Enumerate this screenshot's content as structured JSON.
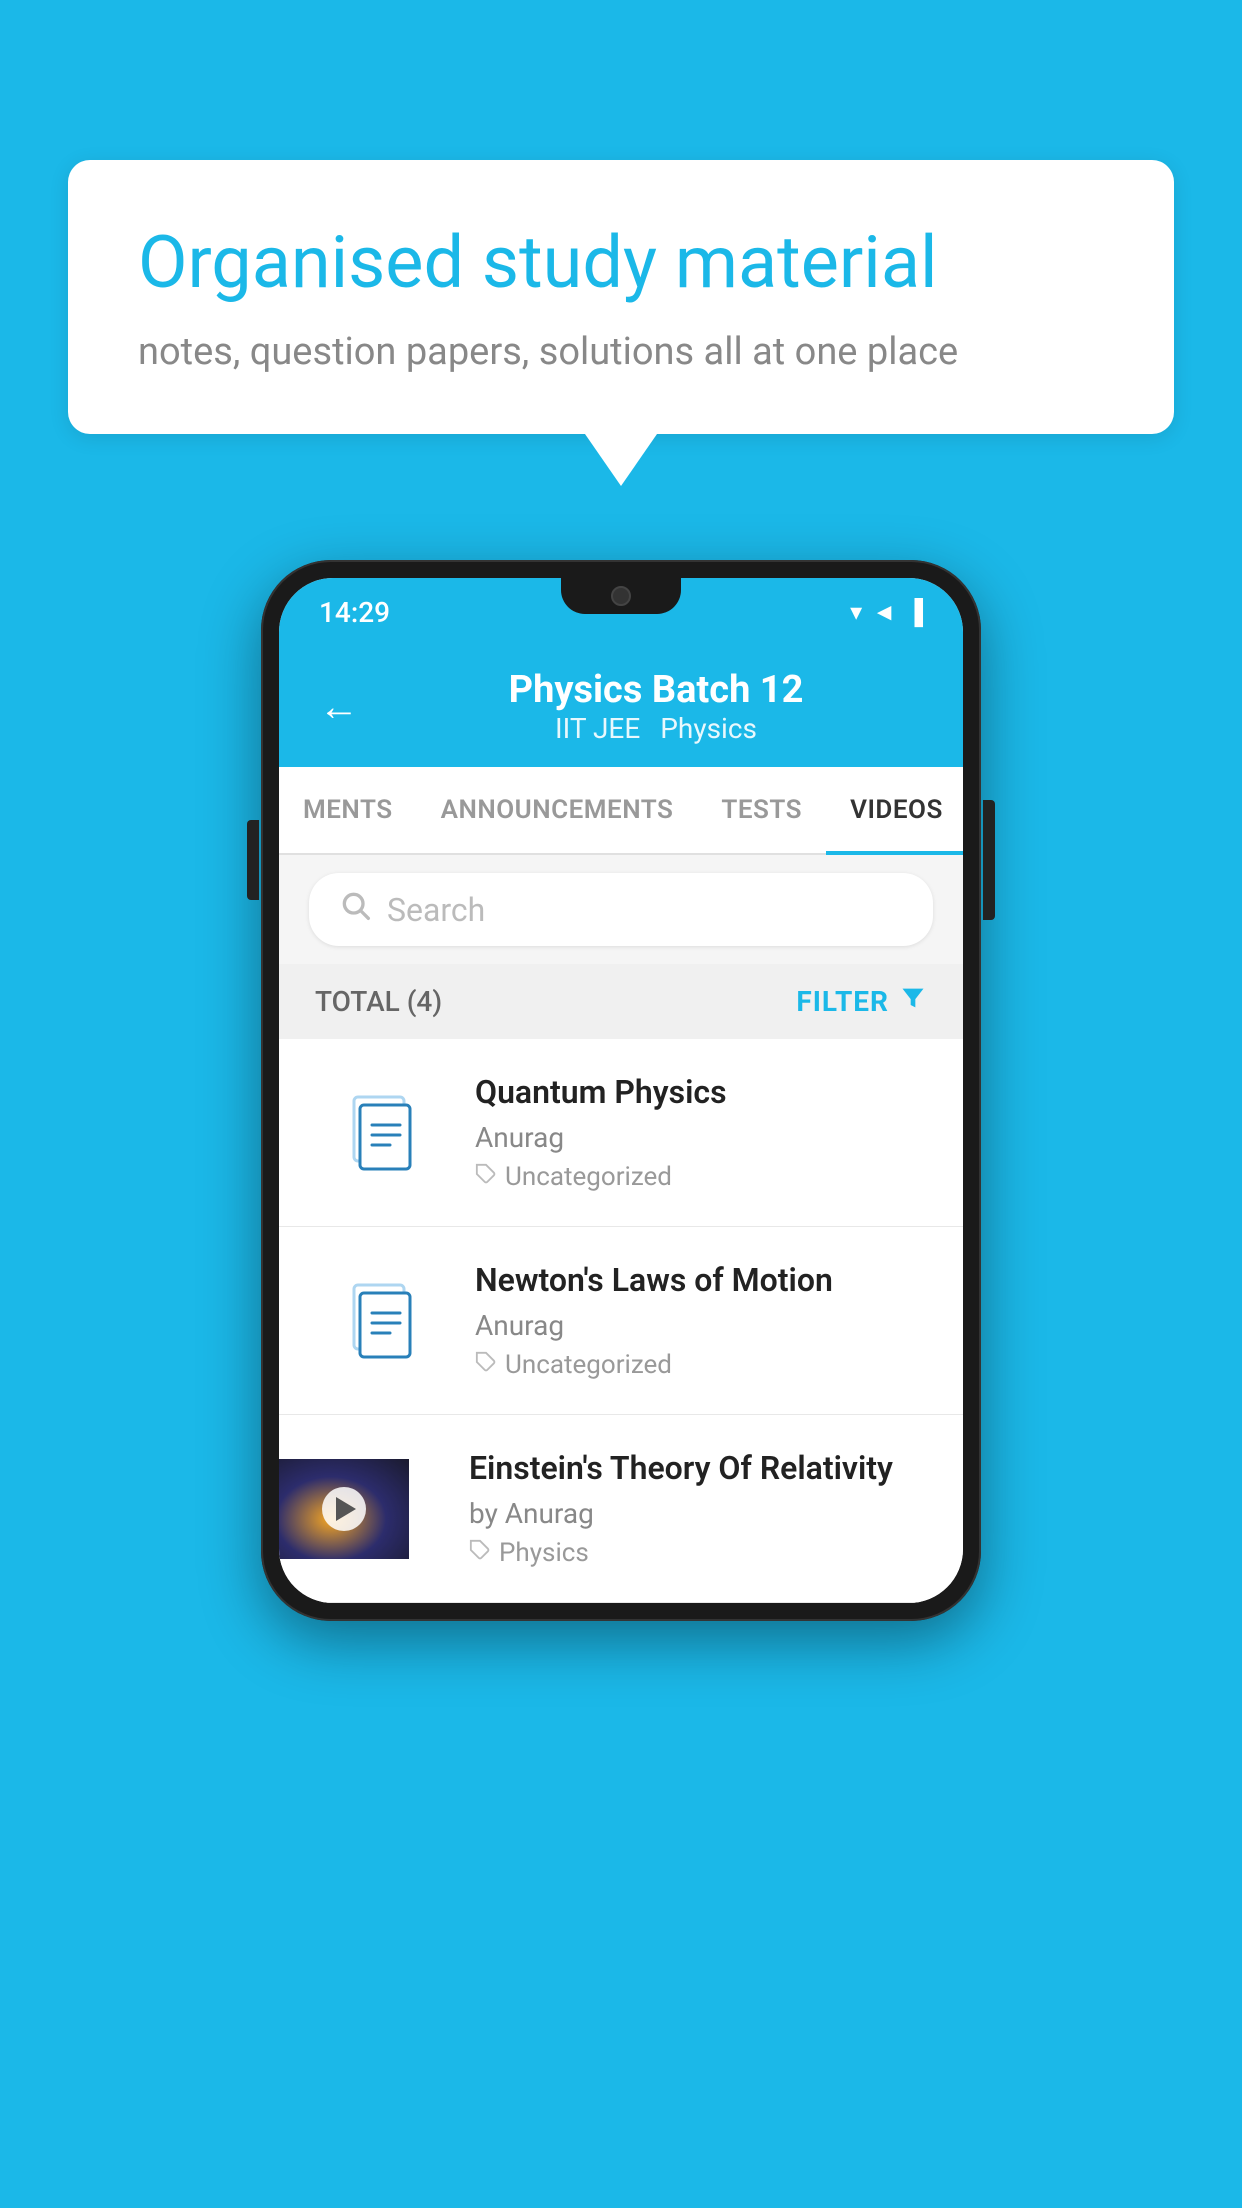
{
  "background_color": "#1bb8e8",
  "speech_bubble": {
    "title": "Organised study material",
    "subtitle": "notes, question papers, solutions all at one place"
  },
  "phone": {
    "status_bar": {
      "time": "14:29"
    },
    "header": {
      "title": "Physics Batch 12",
      "subtitle_left": "IIT JEE",
      "subtitle_right": "Physics",
      "back_label": "←"
    },
    "tabs": [
      {
        "label": "MENTS",
        "active": false
      },
      {
        "label": "ANNOUNCEMENTS",
        "active": false
      },
      {
        "label": "TESTS",
        "active": false
      },
      {
        "label": "VIDEOS",
        "active": true
      }
    ],
    "search": {
      "placeholder": "Search"
    },
    "filter_bar": {
      "total_label": "TOTAL (4)",
      "filter_label": "FILTER"
    },
    "videos": [
      {
        "id": 1,
        "title": "Quantum Physics",
        "author": "Anurag",
        "tag": "Uncategorized",
        "has_thumbnail": false
      },
      {
        "id": 2,
        "title": "Newton's Laws of Motion",
        "author": "Anurag",
        "tag": "Uncategorized",
        "has_thumbnail": false
      },
      {
        "id": 3,
        "title": "Einstein's Theory Of Relativity",
        "author": "by Anurag",
        "tag": "Physics",
        "has_thumbnail": true
      }
    ]
  }
}
